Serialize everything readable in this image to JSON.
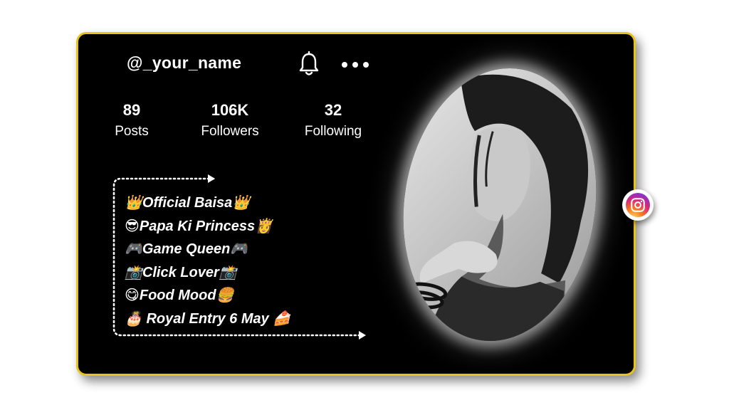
{
  "profile": {
    "username": "@_your_name",
    "stats": [
      {
        "value": "89",
        "label": "Posts"
      },
      {
        "value": "106K",
        "label": "Followers"
      },
      {
        "value": "32",
        "label": "Following"
      }
    ],
    "bio": [
      "👑Official Baisa👑",
      "😎Papa Ki Princess👸",
      "🎮Game Queen🎮",
      "📸Click Lover📸",
      "😋Food Mood🍔",
      "🎂 Royal Entry 6 May 🍰"
    ]
  },
  "icons": {
    "bell": "bell-icon",
    "more": "more-icon",
    "social": "instagram-icon"
  },
  "colors": {
    "card_background": "#000000",
    "border": "#e8c31f",
    "text": "#ffffff"
  }
}
